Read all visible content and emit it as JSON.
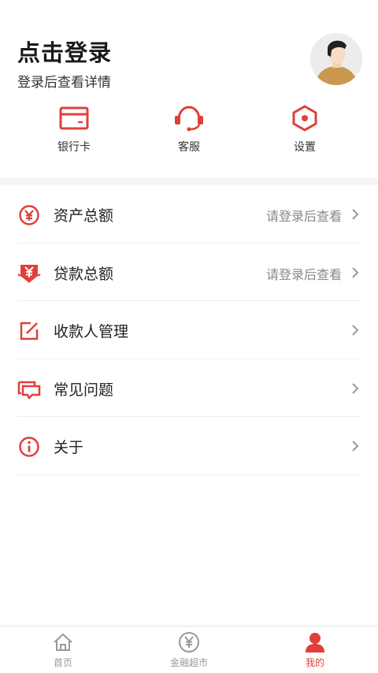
{
  "header": {
    "title": "点击登录",
    "subtitle": "登录后查看详情"
  },
  "shortcuts": [
    {
      "label": "银行卡",
      "icon": "bank-card-icon"
    },
    {
      "label": "客服",
      "icon": "headset-icon"
    },
    {
      "label": "设置",
      "icon": "settings-hexagon-icon"
    }
  ],
  "menu": [
    {
      "label": "资产总额",
      "hint": "请登录后查看",
      "icon": "yen-circle-icon"
    },
    {
      "label": "贷款总额",
      "hint": "请登录后查看",
      "icon": "yen-shield-icon"
    },
    {
      "label": "收款人管理",
      "hint": "",
      "icon": "edit-square-icon"
    },
    {
      "label": "常见问题",
      "hint": "",
      "icon": "chat-bubbles-icon"
    },
    {
      "label": "关于",
      "hint": "",
      "icon": "info-circle-icon"
    }
  ],
  "tabbar": {
    "items": [
      {
        "label": "首页",
        "icon": "home-icon",
        "active": false
      },
      {
        "label": "金融超市",
        "icon": "yen-coin-icon",
        "active": false
      },
      {
        "label": "我的",
        "icon": "user-icon",
        "active": true
      }
    ]
  },
  "colors": {
    "accent": "#e0403a",
    "inactive": "#999999",
    "divider": "#efefef"
  }
}
